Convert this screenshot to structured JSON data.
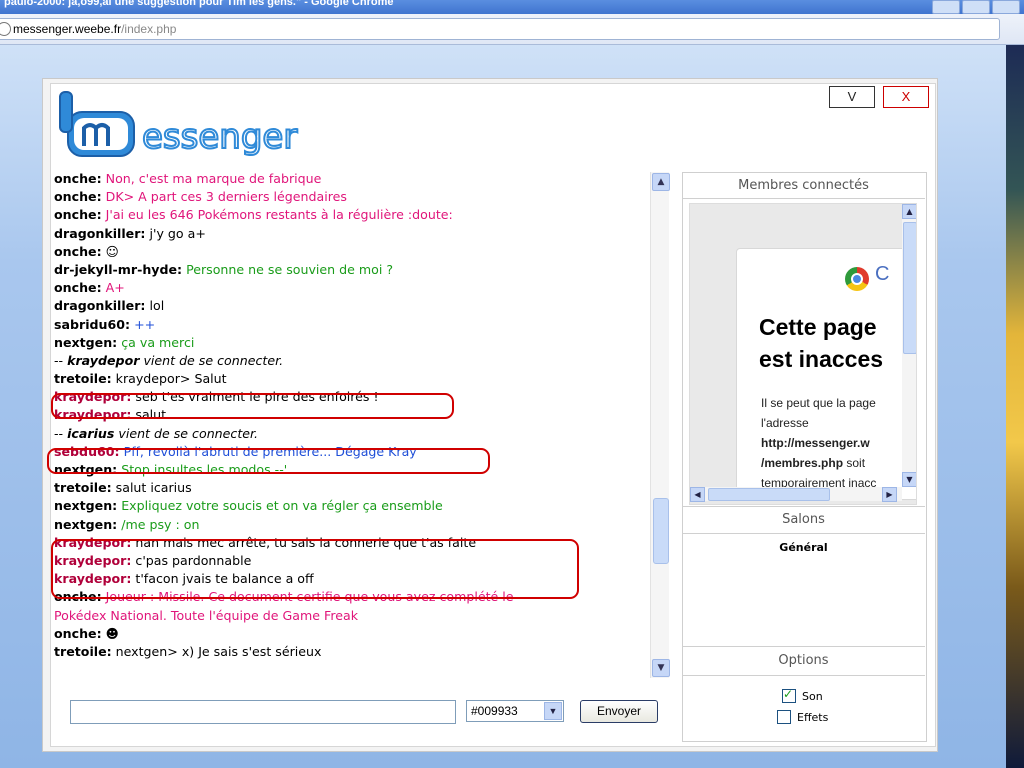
{
  "browser": {
    "title": "paulo-2000: ja,o99,ai une suggestion pour Tim les gens.\" - Google Chrome",
    "url_host": "messenger.weebe.fr",
    "url_path": "/index.php"
  },
  "app": {
    "logo_text": "messenger",
    "btn_v": "V",
    "btn_x": "X"
  },
  "chat": {
    "messages": [
      {
        "nick": "onche:",
        "text": " Non, c'est ma marque de fabrique",
        "color": "#e0157a"
      },
      {
        "nick": "onche:",
        "text": " DK> A part ces 3 derniers légendaires",
        "color": "#e0157a"
      },
      {
        "nick": "onche:",
        "text": " J'ai eu les 646 Pokémons restants à la régulière :doute:",
        "color": "#e0157a"
      },
      {
        "nick": "dragonkiller:",
        "text": " j'y go a+",
        "color": "#000000"
      },
      {
        "nick": "onche:",
        "text": " ☺",
        "color": "#000000"
      },
      {
        "nick": "dr-jekyll-mr-hyde:",
        "text": " Personne ne se souvien de moi ?",
        "color": "#1a9c1a"
      },
      {
        "nick": "onche:",
        "text": " A+",
        "color": "#e0157a"
      },
      {
        "nick": "dragonkiller:",
        "text": " lol",
        "color": "#000000"
      },
      {
        "nick": "sabridu60:",
        "text": " ++",
        "color": "#1f4fd8"
      },
      {
        "nick": "nextgen:",
        "text": " ça va merci",
        "color": "#1a9c1a"
      },
      {
        "nick": "-- ",
        "text": "kraydepor vient de se connecter.",
        "color": "#000000",
        "sys": true,
        "user": "kraydepor",
        "rest": " vient de se connecter."
      },
      {
        "nick": "tretoile:",
        "text": " kraydepor> Salut",
        "color": "#000000"
      },
      {
        "nick": "kraydepor:",
        "text": " seb t'es vraiment le pire des enfoirés !",
        "color": "#000000",
        "nickcolor": "#b0003a"
      },
      {
        "nick": "kraydepor:",
        "text": " salut",
        "color": "#000000",
        "nickcolor": "#b0003a"
      },
      {
        "nick": "-- ",
        "text": "icarius vient de se connecter.",
        "color": "#000000",
        "sys": true,
        "user": "icarius",
        "rest": " vient de se connecter."
      },
      {
        "nick": "sebdu60:",
        "text": " Pff, revoilà l'abruti de première... Dégage Kray",
        "color": "#1f4fd8",
        "nickcolor": "#b0003a"
      },
      {
        "nick": "nextgen:",
        "text": " Stop insultes les modos --'",
        "color": "#1a9c1a"
      },
      {
        "nick": "tretoile:",
        "text": " salut icarius",
        "color": "#000000"
      },
      {
        "nick": "nextgen:",
        "text": " Expliquez votre soucis et on va régler ça ensemble",
        "color": "#1a9c1a"
      },
      {
        "nick": "nextgen:",
        "text": " /me psy : on",
        "color": "#1a9c1a"
      },
      {
        "nick": "kraydepor:",
        "text": " nan mais mec arrête, tu sais la connerie que t'as faite",
        "color": "#000000",
        "nickcolor": "#b0003a"
      },
      {
        "nick": "kraydepor:",
        "text": " c'pas pardonnable",
        "color": "#000000",
        "nickcolor": "#b0003a"
      },
      {
        "nick": "kraydepor:",
        "text": " t'facon jvais te balance a off",
        "color": "#000000",
        "nickcolor": "#b0003a"
      },
      {
        "nick": "onche:",
        "text": " Joueur : Missile. Ce document certifie que vous avez complété le",
        "color": "#e0157a"
      },
      {
        "nick": "",
        "text": "Pokédex National. Toute l'équipe de Game Freak",
        "color": "#e0157a"
      },
      {
        "nick": "onche:",
        "text": " ☻",
        "color": "#000000"
      },
      {
        "nick": "tretoile:",
        "text": " nextgen> x) Je sais s'est sérieux",
        "color": "#000000"
      }
    ],
    "input_value": "",
    "color_value": "#009933",
    "send_label": "Envoyer"
  },
  "members": {
    "header": "Membres connectés",
    "embedded": {
      "brand": "C",
      "headline_1": "Cette page",
      "headline_2": "est inacces",
      "p1": "Il se peut que la page",
      "p2": "l'adresse",
      "p3": "http://messenger.w",
      "p4a": "/membres.php",
      "p4b": " soit",
      "p5": "temporairement inacc"
    }
  },
  "salons": {
    "header": "Salons",
    "items": [
      "Général"
    ]
  },
  "options": {
    "header": "Options",
    "son_label": "Son",
    "son_checked": true,
    "effets_label": "Effets",
    "effets_checked": false
  }
}
